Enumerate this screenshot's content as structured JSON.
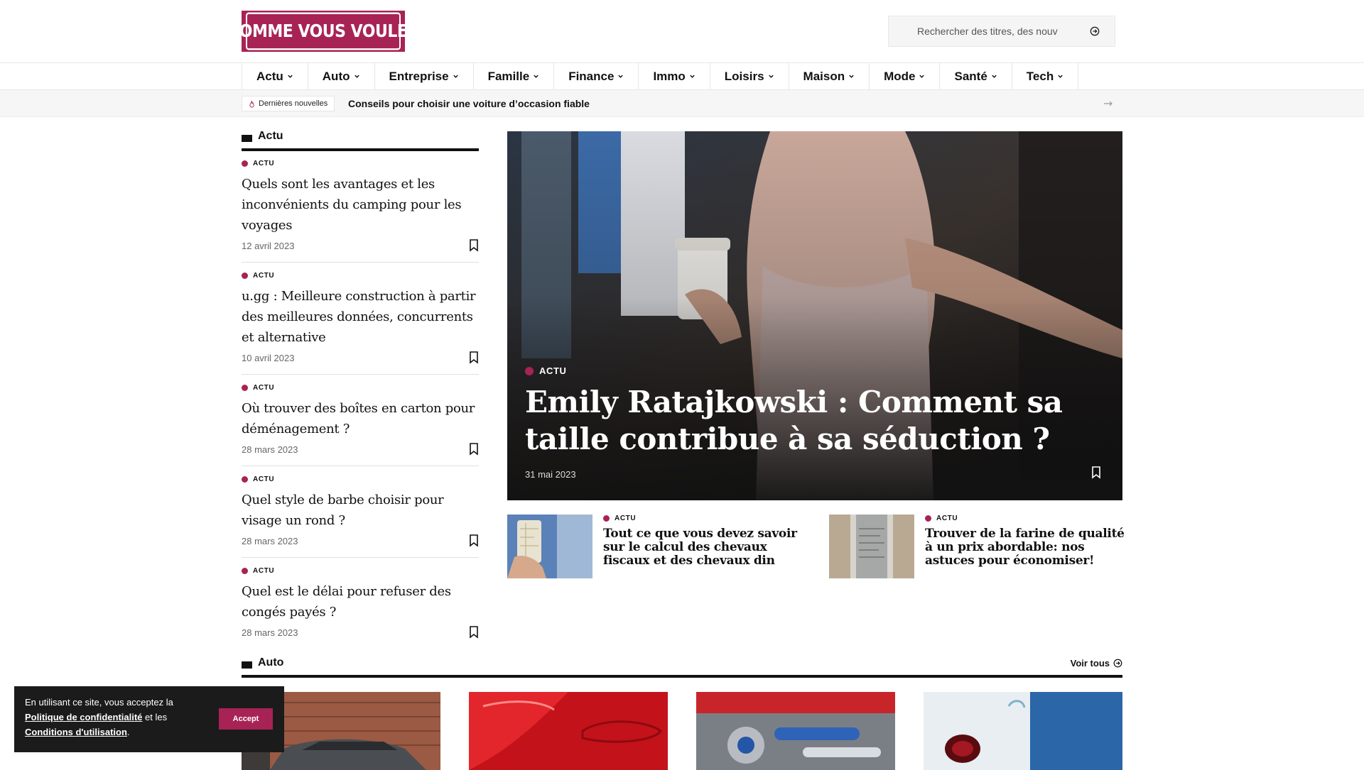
{
  "header": {
    "logo_text": "COMME VOUS VOULEZ",
    "search_placeholder": "Rechercher des titres, des nouv"
  },
  "nav": {
    "items": [
      {
        "label": "Actu"
      },
      {
        "label": "Auto"
      },
      {
        "label": "Entreprise"
      },
      {
        "label": "Famille"
      },
      {
        "label": "Finance"
      },
      {
        "label": "Immo"
      },
      {
        "label": "Loisirs"
      },
      {
        "label": "Maison"
      },
      {
        "label": "Mode"
      },
      {
        "label": "Santé"
      },
      {
        "label": "Tech"
      }
    ]
  },
  "ticker": {
    "badge": "Dernières nouvelles",
    "headline": "Conseils pour choisir une voiture d’occasion fiable"
  },
  "actu_section": {
    "title": "Actu",
    "articles": [
      {
        "category": "ACTU",
        "title": "Quels sont les avantages et les inconvénients du camping pour les voyages",
        "date": "12 avril 2023"
      },
      {
        "category": "ACTU",
        "title": "u.gg : Meilleure construction à partir des meilleures données, concurrents et alternative",
        "date": "10 avril 2023"
      },
      {
        "category": "ACTU",
        "title": "Où trouver des boîtes en carton pour déménagement ?",
        "date": "28 mars 2023"
      },
      {
        "category": "ACTU",
        "title": "Quel style de barbe choisir pour visage un rond ?",
        "date": "28 mars 2023"
      },
      {
        "category": "ACTU",
        "title": "Quel est le délai pour refuser des congés payés ?",
        "date": "28 mars 2023"
      }
    ]
  },
  "hero": {
    "category": "ACTU",
    "title": "Emily Ratajkowski : Comment sa taille contribue à sa séduction ?",
    "date": "31 mai 2023"
  },
  "cards": [
    {
      "category": "ACTU",
      "title": "Tout ce que vous devez savoir sur le calcul des chevaux fiscaux et des chevaux din"
    },
    {
      "category": "ACTU",
      "title": "Trouver de la farine de qualité à un prix abordable: nos astuces pour économiser!"
    }
  ],
  "auto_section": {
    "title": "Auto",
    "see_all": "Voir tous"
  },
  "cookie": {
    "text_before": "En utilisant ce site, vous acceptez la",
    "privacy_link": "Politique de confidentialité",
    "text_middle": "et les",
    "terms_link": "Conditions d'utilisation",
    "text_end": ".",
    "accept_label": "Accept"
  },
  "colors": {
    "accent": "#a82355",
    "text": "#111111",
    "cookie_bg": "#1b1b1b"
  },
  "icons": {
    "chevron": "chevron-down-icon",
    "search": "arrow-circle-right-icon",
    "bookmark": "bookmark-icon",
    "flame": "flame-icon",
    "arrow": "arrow-right-icon"
  }
}
